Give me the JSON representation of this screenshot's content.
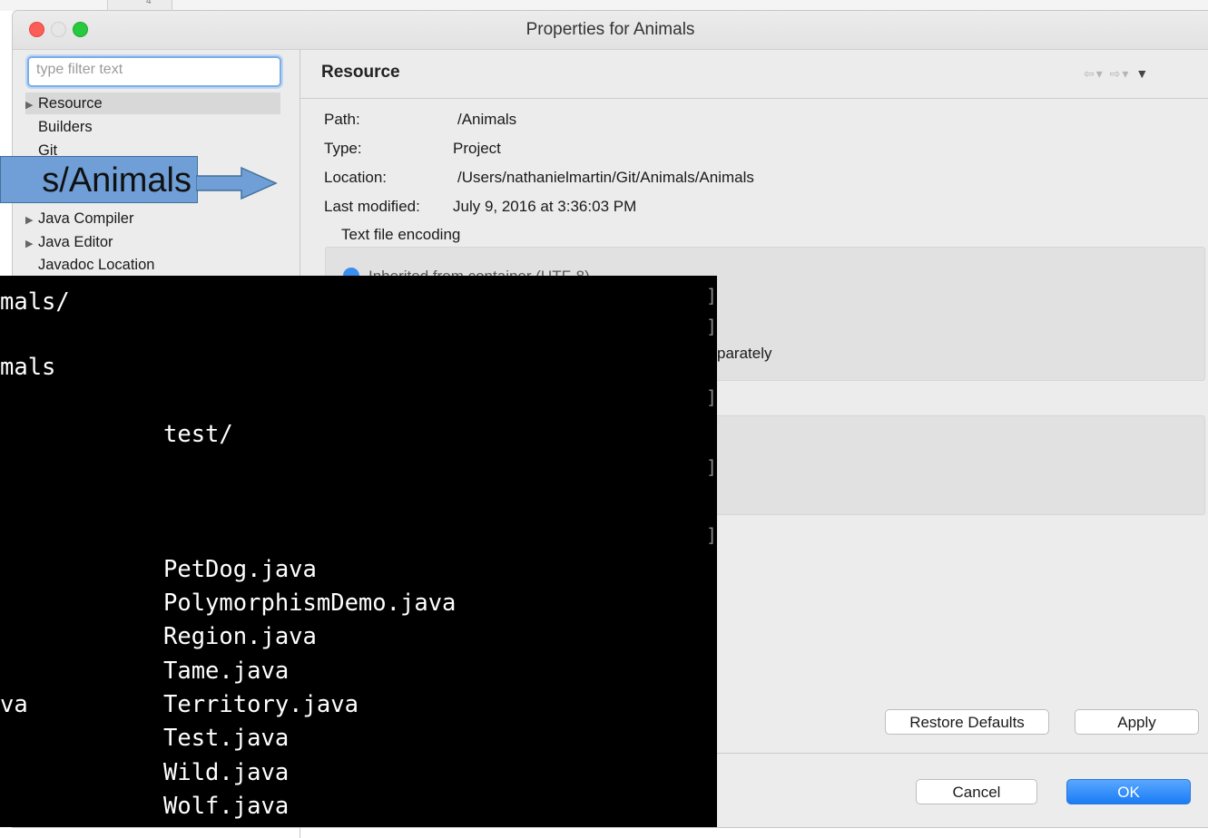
{
  "background": {
    "tab_fragment": "4"
  },
  "window": {
    "title": "Properties for Animals",
    "controls": [
      "close-icon",
      "minimize-icon",
      "zoom-icon"
    ]
  },
  "filter": {
    "placeholder": "type filter text"
  },
  "tree": {
    "items": [
      {
        "label": "Resource",
        "expandable": true,
        "selected": true
      },
      {
        "label": "Builders",
        "expandable": false
      },
      {
        "label": "Git",
        "expandable": false
      },
      {
        "label": "Java Compiler",
        "expandable": true
      },
      {
        "label": "Java Editor",
        "expandable": true
      },
      {
        "label": "Javadoc Location",
        "expandable": false
      }
    ]
  },
  "page": {
    "title": "Resource",
    "nav_icons": [
      "back-arrow-icon",
      "forward-arrow-icon",
      "view-menu-icon"
    ],
    "info": {
      "path_label": "Path:",
      "path_value": "/Animals",
      "type_label": "Type:",
      "type_value": "Project",
      "location_label": "Location:",
      "location_value": "/Users/nathanielmartin/Git/Animals/Animals",
      "modified_label": "Last modified:",
      "modified_value": "July 9, 2016 at 3:36:03 PM"
    },
    "encoding_group_title": "Text file encoding",
    "encoding_option_fragment": "Inherited from container (UTF-8)",
    "separately_fragment": "parately"
  },
  "buttons": {
    "restore_defaults": "Restore Defaults",
    "apply": "Apply",
    "cancel": "Cancel",
    "ok": "OK"
  },
  "callout": {
    "text": "s/Animals"
  },
  "terminal": {
    "lines": [
      "mals/",
      "mals",
      "test/",
      "PetDog.java",
      "PolymorphismDemo.java",
      "Region.java",
      "Tame.java",
      "va",
      "Territory.java",
      "Test.java",
      "Wild.java",
      "Wolf.java"
    ],
    "bracket": "]"
  },
  "colors": {
    "accent": "#1a7cf5",
    "callout_fill": "#6f9fd6",
    "terminal_bg": "#000000",
    "terminal_fg": "#ffffff"
  }
}
